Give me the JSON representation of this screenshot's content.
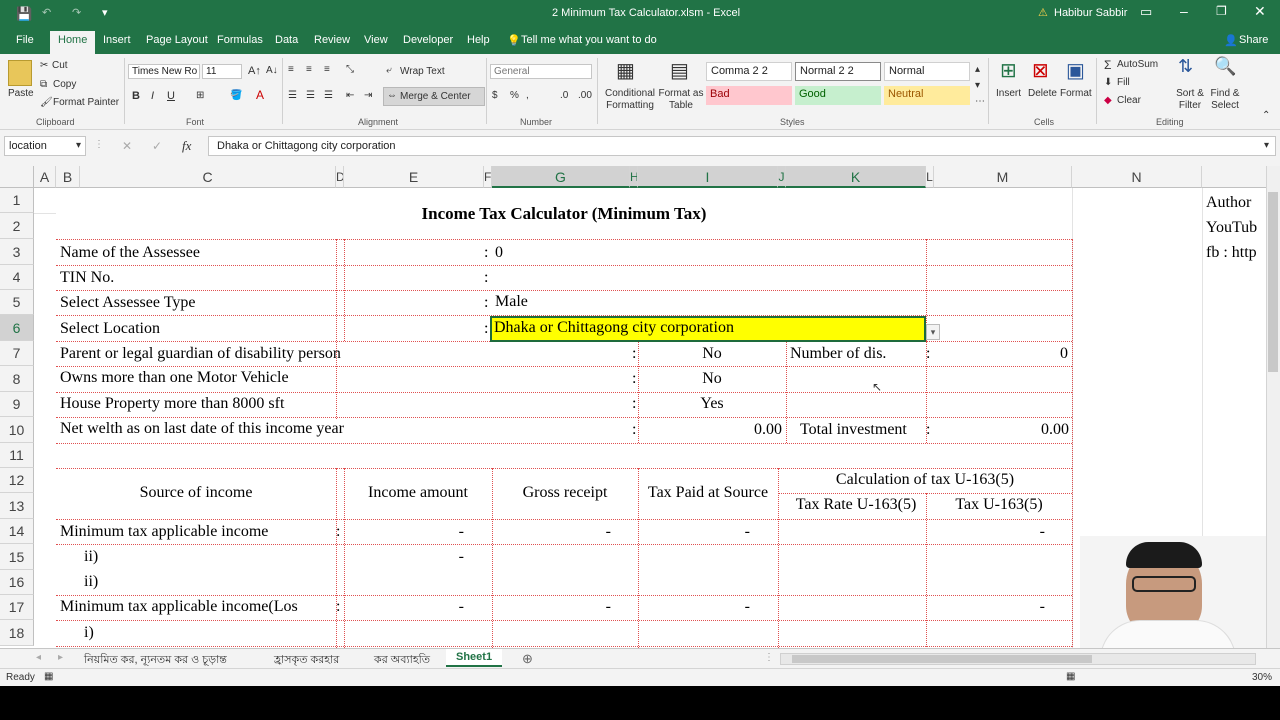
{
  "window": {
    "title": "2 Minimum Tax Calculator.xlsm - Excel",
    "user": "Habibur Sabbir",
    "warning_glyph": "⚠"
  },
  "ribbon_tabs": [
    "File",
    "Home",
    "Insert",
    "Page Layout",
    "Formulas",
    "Data",
    "Review",
    "View",
    "Developer",
    "Help"
  ],
  "tell_me": "Tell me what you want to do",
  "share_label": "Share",
  "clipboard": {
    "paste": "Paste",
    "cut": "Cut",
    "copy": "Copy",
    "format_painter": "Format Painter",
    "group": "Clipboard"
  },
  "font": {
    "name": "Times New Ro",
    "size": "11",
    "bold": "B",
    "italic": "I",
    "underline": "U",
    "group": "Font"
  },
  "alignment": {
    "wrap": "Wrap Text",
    "merge": "Merge & Center",
    "group": "Alignment"
  },
  "number": {
    "format": "General",
    "group": "Number"
  },
  "styles": {
    "conditional": "Conditional Formatting",
    "format_table": "Format as Table",
    "items": [
      "Comma 2 2",
      "Normal 2 2",
      "Normal",
      "Bad",
      "Good",
      "Neutral"
    ],
    "group": "Styles"
  },
  "cells": {
    "insert": "Insert",
    "delete": "Delete",
    "format": "Format",
    "group": "Cells"
  },
  "editing": {
    "autosum": "AutoSum",
    "fill": "Fill",
    "clear": "Clear",
    "sort": "Sort & Filter",
    "find": "Find & Select",
    "group": "Editing"
  },
  "formula_bar": {
    "name_box": "location",
    "fx": "fx",
    "content": "Dhaka or Chittagong city corporation"
  },
  "columns": [
    "A",
    "B",
    "C",
    "D",
    "E",
    "F",
    "G",
    "H",
    "I",
    "J",
    "K",
    "L",
    "M",
    "N"
  ],
  "rows": [
    "1",
    "2",
    "3",
    "4",
    "5",
    "6",
    "7",
    "8",
    "9",
    "10",
    "11",
    "12",
    "13",
    "14",
    "15",
    "16",
    "17",
    "18"
  ],
  "sheet": {
    "title": "Income Tax Calculator (Minimum Tax)",
    "r3_label": "Name of the Assessee",
    "r3_value": "0",
    "r4_label": "TIN No.",
    "r5_label": "Select Assessee Type",
    "r5_value": "Male",
    "r6_label": "Select Location",
    "r6_value": "Dhaka or Chittagong city corporation",
    "r7_label": "Parent or legal guardian of disability person",
    "r7_value": "No",
    "r7_k": "Number of dis.",
    "r7_m": "0",
    "r8_label": "Owns more than one Motor Vehicle",
    "r8_value": "No",
    "r9_label": "House Property more than 8000 sft",
    "r9_value": "Yes",
    "r10_label": "Net welth as on last date of this income year",
    "r10_value": "0.00",
    "r10_k": "Total investment",
    "r10_m": "0.00",
    "colon": ":",
    "h_source": "Source of income",
    "h_income": "Income amount",
    "h_gross": "Gross receipt",
    "h_tax_paid": "Tax Paid at Source",
    "h_calc": "Calculation of tax U-163(5)",
    "h_rate": "Tax Rate U-163(5)",
    "h_tax": "Tax U-163(5)",
    "r14_label": "Minimum tax applicable income",
    "r15_label": "ii)",
    "r16_label": "ii)",
    "r17_label": "Minimum tax applicable income(Los",
    "r18_label": "i)",
    "dash": "-",
    "side_n1": "Author",
    "side_n2": "YouTub",
    "side_n3": "fb : http"
  },
  "sheet_tabs": [
    "নিয়মিত কর, ন্যূনতম কর ও চূড়ান্ত",
    "হ্রাসকৃত করহার",
    "কর অব্যাহতি",
    "Sheet1"
  ],
  "status": {
    "ready": "Ready",
    "zoom": "30%"
  },
  "colors": {
    "excel_green": "#217346",
    "highlight_yellow": "#ffff00",
    "bad": "#ffc7ce",
    "good": "#c6efce",
    "neutral": "#ffeb9c"
  }
}
